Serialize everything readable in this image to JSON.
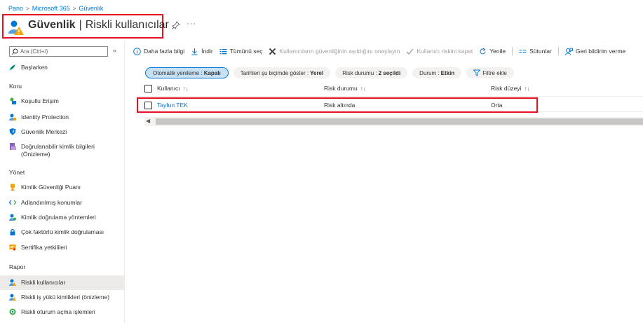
{
  "breadcrumb": {
    "items": [
      "Pano",
      "Microsoft 365",
      "Güvenlik"
    ]
  },
  "header": {
    "title_strong": "Güvenlik",
    "title_sep": "|",
    "title_rest": "Riskli kullanıcılar",
    "more": "···"
  },
  "search": {
    "placeholder": "Ara (Ctrl+/)"
  },
  "sidebar": {
    "collapse": "«",
    "top_item": "Başlarken",
    "sections": [
      {
        "label": "Koru",
        "items": [
          "Koşullu Erişim",
          "Identity Protection",
          "Güvenlik Merkezi",
          "Doğrulanabilir kimlik bilgileri (Önizleme)"
        ]
      },
      {
        "label": "Yönet",
        "items": [
          "Kimlik Güvenliği Puanı",
          "Adlandırılmış konumlar",
          "Kimlik doğrulama yöntemleri",
          "Çok faktörlü kimlik doğrulaması",
          "Sertifika yetkilileri"
        ]
      },
      {
        "label": "Rapor",
        "items": [
          "Riskli kullanıcılar",
          "Riskli iş yükü kimlikleri (önizleme)",
          "Riskli oturum açma işlemleri"
        ]
      }
    ]
  },
  "toolbar": {
    "more_info": "Daha fazla bilgi",
    "download": "İndir",
    "select_all": "Tümünü seç",
    "confirm_compromised": "Kullanıcıların güvenliğinin aşıldığını onaylayın",
    "dismiss_risk": "Kullanıcı riskini kapat",
    "refresh": "Yenile",
    "columns": "Sütunlar",
    "feedback": "Geri bildirim verme"
  },
  "filters": [
    {
      "label": "Otomatik yenileme :",
      "value": "Kapalı"
    },
    {
      "label": "Tarihleri şu biçimde göster :",
      "value": "Yerel"
    },
    {
      "label": "Risk durumu :",
      "value": "2 seçildi"
    },
    {
      "label": "Durum :",
      "value": "Etkin"
    }
  ],
  "add_filter": "Filtre ekle",
  "table": {
    "columns": [
      "Kullanıcı",
      "Risk durumu",
      "Risk düzeyi"
    ],
    "sort_glyph": "↑↓",
    "rows": [
      {
        "user": "Tayfun TEK",
        "risk_state": "Risk altında",
        "risk_level": "Orta"
      }
    ]
  },
  "scrollbar": {
    "left_arrow": "◀"
  },
  "colors": {
    "accent": "#0078d4",
    "highlight": "#e81123",
    "active_nav": "#edebe9"
  }
}
